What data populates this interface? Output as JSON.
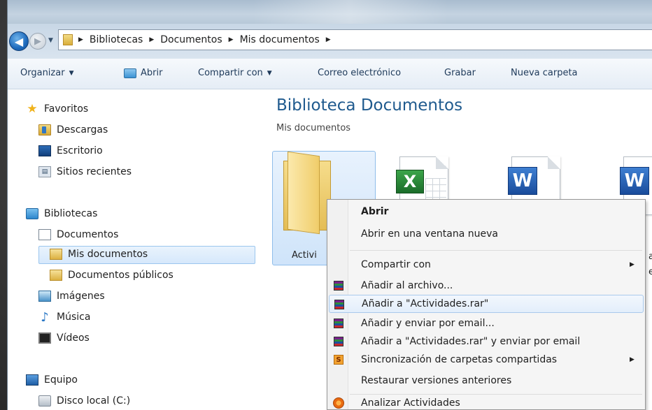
{
  "address": {
    "crumbs": [
      "Bibliotecas",
      "Documentos",
      "Mis documentos"
    ]
  },
  "toolbar": {
    "organize": "Organizar",
    "open": "Abrir",
    "share": "Compartir con",
    "email": "Correo electrónico",
    "burn": "Grabar",
    "new_folder": "Nueva carpeta"
  },
  "sidebar": {
    "favorites": "Favoritos",
    "downloads": "Descargas",
    "desktop": "Escritorio",
    "recent": "Sitios recientes",
    "libraries": "Bibliotecas",
    "documents": "Documentos",
    "my_documents": "Mis documentos",
    "public_documents": "Documentos públicos",
    "images": "Imágenes",
    "music": "Música",
    "videos": "Vídeos",
    "computer": "Equipo",
    "local_disk": "Disco local (C:)"
  },
  "content": {
    "title": "Biblioteca Documentos",
    "subtitle": "Mis documentos",
    "folder_label": "Activi",
    "clipped_a": "a",
    "clipped_e": "e"
  },
  "context_menu": {
    "open": "Abrir",
    "open_new_window": "Abrir en una ventana nueva",
    "share_with": "Compartir con",
    "add_to_archive": "Añadir al archivo...",
    "add_to_rar": "Añadir a \"Actividades.rar\"",
    "add_and_email": "Añadir y enviar por email...",
    "add_rar_and_email": "Añadir a \"Actividades.rar\" y enviar por email",
    "sync_shared": "Sincronización de carpetas compartidas",
    "restore_versions": "Restaurar versiones anteriores",
    "scan": "Analizar Actividades"
  }
}
